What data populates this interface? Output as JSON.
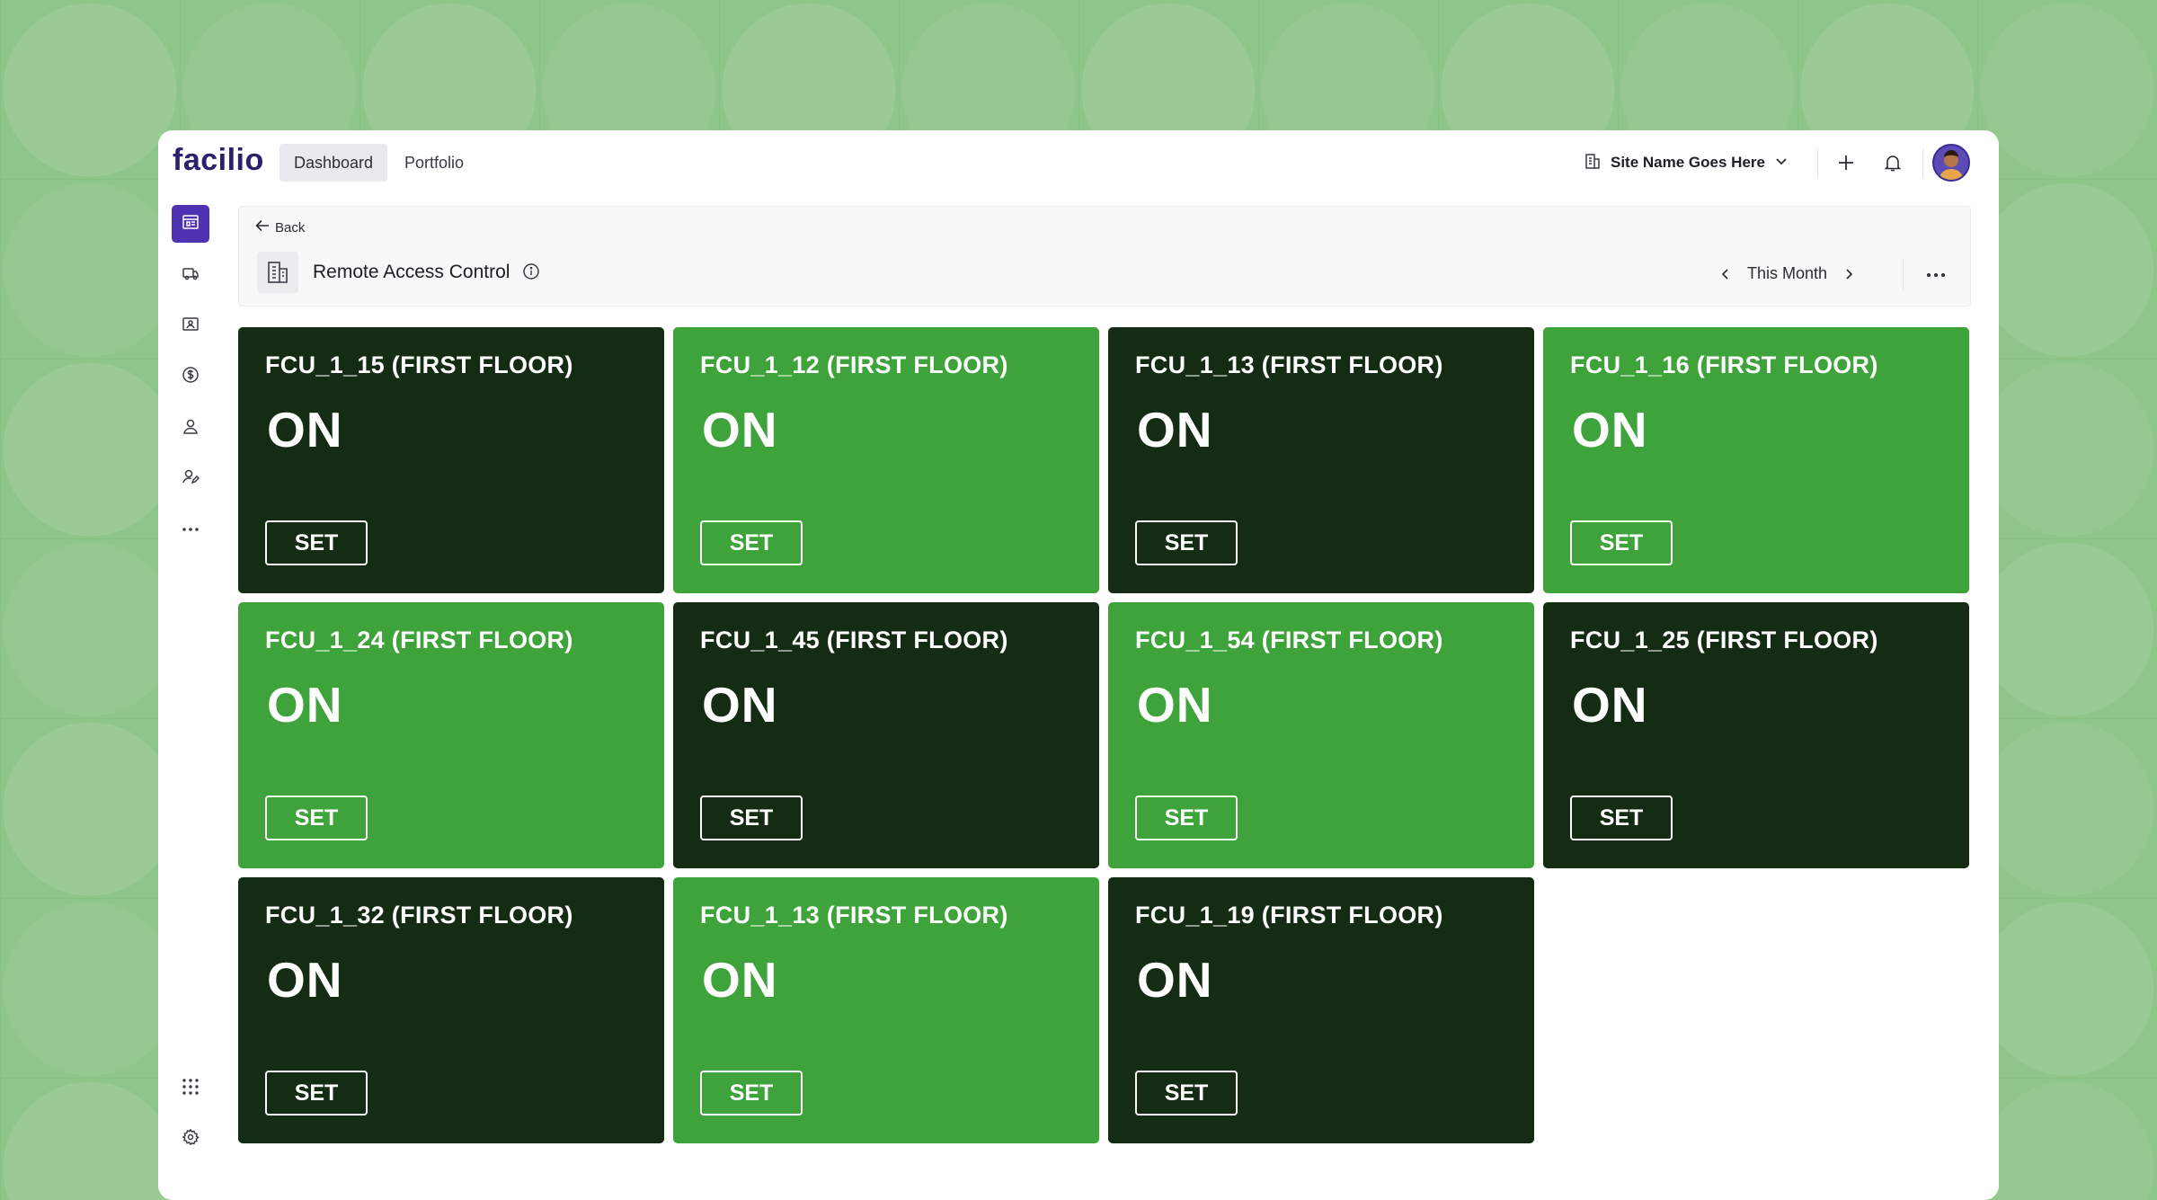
{
  "app": {
    "logo": "facilio",
    "nav_tabs": [
      {
        "label": "Dashboard",
        "active": true
      },
      {
        "label": "Portfolio",
        "active": false
      }
    ],
    "site_selector": "Site Name Goes Here",
    "accent_color": "#4e32b2"
  },
  "sidebar": {
    "items": [
      "dashboard-icon",
      "truck-icon",
      "monitor-person-icon",
      "dollar-icon",
      "user-icon",
      "user-edit-icon",
      "more-horizontal-icon"
    ],
    "bottom": [
      "apps-grid-icon",
      "settings-icon"
    ]
  },
  "header": {
    "back_label": "Back",
    "title": "Remote Access Control",
    "period": "This Month"
  },
  "cards": [
    {
      "title": "FCU_1_15 (FIRST FLOOR)",
      "status": "ON",
      "button": "SET",
      "theme": "dark"
    },
    {
      "title": "FCU_1_12 (FIRST FLOOR)",
      "status": "ON",
      "button": "SET",
      "theme": "green"
    },
    {
      "title": "FCU_1_13 (FIRST FLOOR)",
      "status": "ON",
      "button": "SET",
      "theme": "dark"
    },
    {
      "title": "FCU_1_16 (FIRST FLOOR)",
      "status": "ON",
      "button": "SET",
      "theme": "green"
    },
    {
      "title": "FCU_1_24 (FIRST FLOOR)",
      "status": "ON",
      "button": "SET",
      "theme": "green"
    },
    {
      "title": "FCU_1_45 (FIRST FLOOR)",
      "status": "ON",
      "button": "SET",
      "theme": "dark"
    },
    {
      "title": "FCU_1_54 (FIRST FLOOR)",
      "status": "ON",
      "button": "SET",
      "theme": "green"
    },
    {
      "title": "FCU_1_25 (FIRST FLOOR)",
      "status": "ON",
      "button": "SET",
      "theme": "dark"
    },
    {
      "title": "FCU_1_32 (FIRST FLOOR)",
      "status": "ON",
      "button": "SET",
      "theme": "dark"
    },
    {
      "title": "FCU_1_13 (FIRST FLOOR)",
      "status": "ON",
      "button": "SET",
      "theme": "green"
    },
    {
      "title": "FCU_1_19 (FIRST FLOOR)",
      "status": "ON",
      "button": "SET",
      "theme": "dark"
    }
  ],
  "colors": {
    "card_dark": "#142c14",
    "card_green": "#3fa33b",
    "background": "#8ec588"
  }
}
